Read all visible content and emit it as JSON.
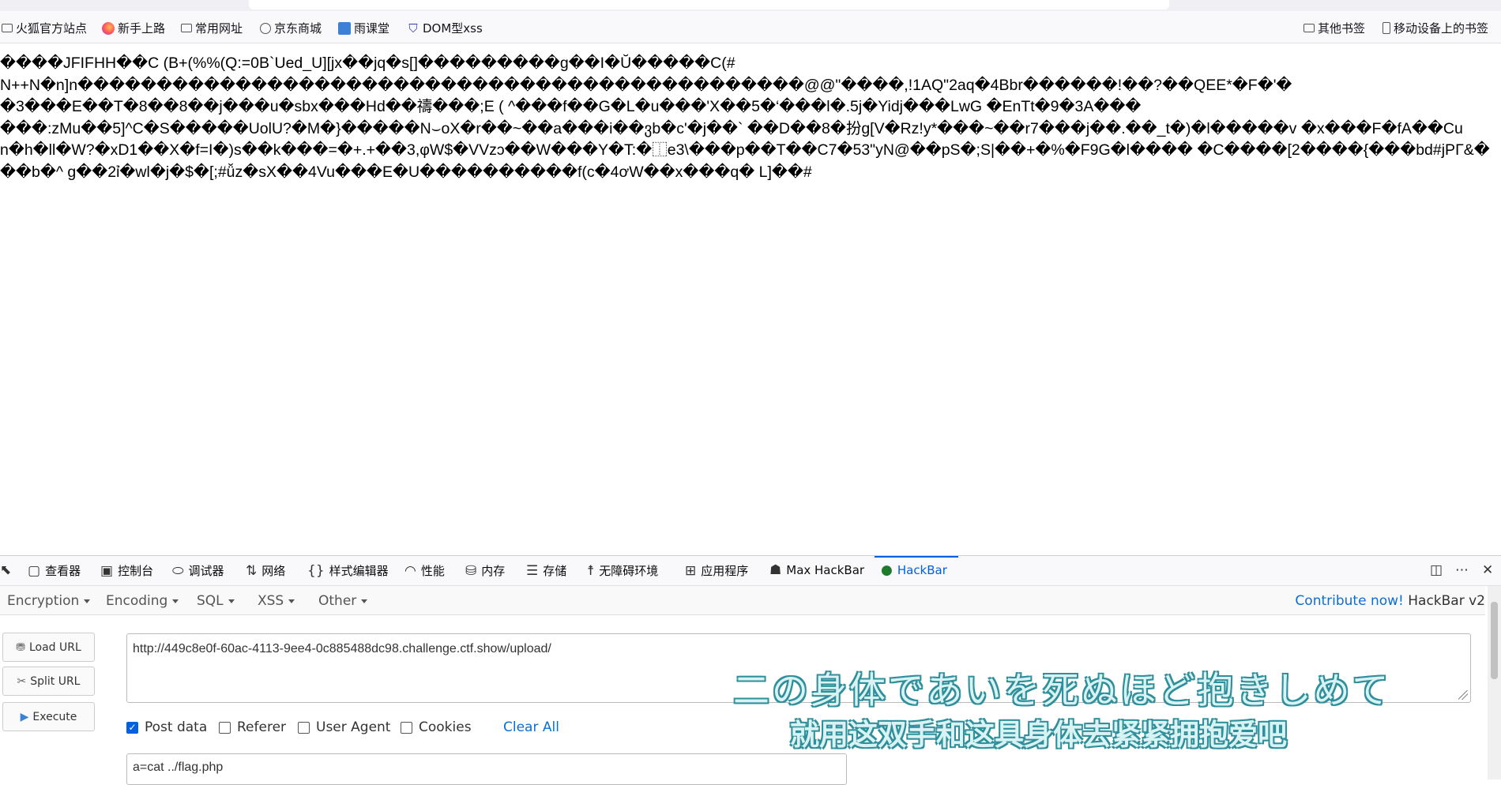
{
  "bookmarks": {
    "left": [
      "火狐官方站点",
      "新手上路",
      "常用网址",
      "京东商城",
      "雨课堂",
      "DOM型xss"
    ],
    "right": [
      "其他书签",
      "移动设备上的书签"
    ]
  },
  "page": {
    "lines": [
      "����JFIFHH��C (B+(%%(Q:=0B`Ued_U][jx��jq�s[]���������g��I�Ŭ�����C(#",
      "N++N�n]n����������������������������������������������@@\"����,!1AQ\"2aq�4Bbr������!��?��QEE*�F�'�",
      "�3���E��T�8��8��j���u�sbx���Hd��禱���;E ( ^���f��G�L�u���'X��5�‘���l�.5j�Yidj���LwG �EnTt�9�3A���",
      "���:zMu��5]^C�S�����UolU?�M�}�����N⌣oX�r��~��a���i��ვb�c'�j��` ��D��8�扮g[V�Rz!y*���~��r7���j��.��_t�)�l�����v �x���F�fA��Cu",
      "n�h�ll�W?�xD1��X�f=I�)s��k���=�+.+��3,φW$�VVzↄ��W���Y�T:�⿰e3\\���p��T��C7�53\"yN@��pS�;S|��+�%�F9G�l���� �C����[2����{���bd#jPΓ&�",
      "��b�^ g��2ỉ�wl�j�$�[;#ǚz�sX��4Vu���E�U����������f(c�4ơW��x���q� L]��#"
    ]
  },
  "devtools": {
    "tabs": [
      "查看器",
      "控制台",
      "调试器",
      "网络",
      "样式编辑器",
      "性能",
      "内存",
      "存储",
      "无障碍环境",
      "应用程序",
      "Max HackBar",
      "HackBar"
    ],
    "active_tab": "HackBar"
  },
  "hackbar": {
    "menu": [
      "Encryption",
      "Encoding",
      "SQL",
      "XSS",
      "Other"
    ],
    "contribute_label": "Contribute now!",
    "version_label": "HackBar v2",
    "buttons": {
      "load": "Load URL",
      "split": "Split URL",
      "execute": "Execute"
    },
    "url_value": "http://449c8e0f-60ac-4113-9ee4-0c885488dc98.challenge.ctf.show/upload/",
    "options": {
      "post_data": {
        "label": "Post data",
        "checked": true
      },
      "referer": {
        "label": "Referer",
        "checked": false
      },
      "user_agent": {
        "label": "User Agent",
        "checked": false
      },
      "cookies": {
        "label": "Cookies",
        "checked": false
      }
    },
    "clear_all": "Clear All",
    "post_value": "a=cat ../flag.php"
  },
  "overlay": {
    "jp_subtitle": "二の身体であいを死ぬほど抱きしめて",
    "cn_subtitle": "就用这双手和这具身体去紧紧拥抱爱吧"
  }
}
